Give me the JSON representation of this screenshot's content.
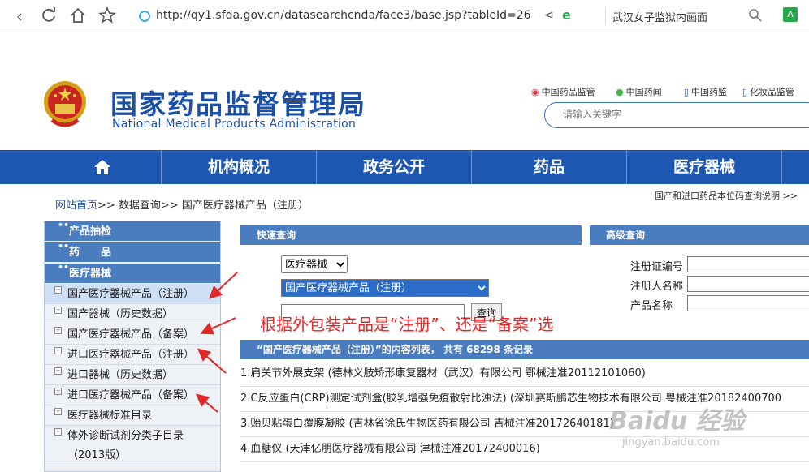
{
  "browser": {
    "url": "http://qy1.sfda.gov.cn/datasearchcnda/face3/base.jsp?tableId=26",
    "tab_title": "武汉女子监狱内画面"
  },
  "header": {
    "title_cn": "国家药品监督管理局",
    "title_en": "National Medical Products Administration",
    "links": [
      "中国药品监管",
      "中国药闻",
      "中国药监",
      "化妆品监管"
    ],
    "search_placeholder": "请输入关键字"
  },
  "nav": {
    "items": [
      "机构概况",
      "政务公开",
      "药品",
      "医疗器械"
    ]
  },
  "breadcrumb": {
    "home": "网站首页",
    "rest": ">> 数据查询>> 国产医疗器械产品（注册）"
  },
  "right_link": "国产和进口药品本位码查询说明 >>",
  "sidebar": {
    "headers": [
      "产品抽检",
      "药　　品",
      "医疗器械"
    ],
    "items": [
      "国产医疗器械产品（注册）",
      "国产器械（历史数据）",
      "国产医疗器械产品（备案）",
      "进口医疗器械产品（注册）",
      "进口器械（历史数据）",
      "进口医疗器械产品（备案）",
      "医疗器械标准目录",
      "体外诊断试剂分类子目录",
      "（2013版）"
    ]
  },
  "quick_search": {
    "title": "快速查询",
    "category": "医疗器械",
    "table": "国产医疗器械产品（注册）",
    "button": "查询"
  },
  "advanced_search": {
    "title": "高级查询",
    "fields": [
      "注册证编号",
      "注册人名称",
      "产品名称"
    ]
  },
  "annotation": "根据外包装产品是“注册”、还是“备案”选",
  "results": {
    "header": "“国产医疗器械产品（注册）”的内容列表，  共有  68298  条记录",
    "rows": [
      "1.肩关节外展支架 (德林义肢矫形康复器材（武汉）有限公司 鄂械注准20112101060)",
      "2.C反应蛋白(CRP)测定试剂盒(胶乳增强免疫散射比浊法) (深圳赛斯鹏芯生物技术有限公司 粤械注准20182400700",
      "3.贻贝粘蛋白覆膜凝胶 (吉林省徐氏生物医药有限公司 吉械注准20172640181)",
      "4.血糖仪 (天津亿朋医疗器械有限公司 津械注准20172400016)"
    ]
  },
  "watermark": {
    "main": "Baidu 经验",
    "sub": "jingyan.baidu.com"
  },
  "colors": {
    "primary": "#1e57b2",
    "panel": "#4a7cc0",
    "annotation": "#e02828"
  },
  "icons": [
    "refresh-icon",
    "home-icon",
    "star-icon",
    "shield-icon",
    "share-icon",
    "search-icon",
    "translate-icon",
    "menu-icon",
    "emblem-icon",
    "weibo-icon",
    "wechat-icon",
    "mobile-icon",
    "arrow-icon"
  ]
}
